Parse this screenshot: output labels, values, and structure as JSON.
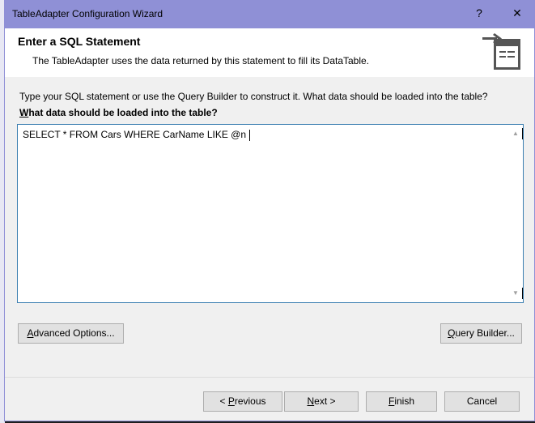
{
  "window": {
    "title": "TableAdapter Configuration Wizard",
    "help": "?",
    "close": "✕"
  },
  "header": {
    "title": "Enter a SQL Statement",
    "subtitle": "The TableAdapter uses the data returned by this statement to fill its DataTable.",
    "icon": "table-import-icon"
  },
  "main": {
    "instruction": "Type your SQL statement or use the Query Builder to construct it. What data should be loaded into the table?",
    "label_u": "W",
    "label_rest": "hat data should be loaded into the table?",
    "sql": "SELECT * FROM Cars WHERE CarName LIKE @n",
    "advanced_u": "A",
    "advanced_rest": "dvanced Options...",
    "query_u": "Q",
    "query_rest": "uery Builder..."
  },
  "footer": {
    "prev_pre": "< ",
    "prev_u": "P",
    "prev_rest": "revious",
    "next_u": "N",
    "next_rest": "ext >",
    "finish_u": "F",
    "finish_rest": "inish",
    "cancel": "Cancel"
  }
}
